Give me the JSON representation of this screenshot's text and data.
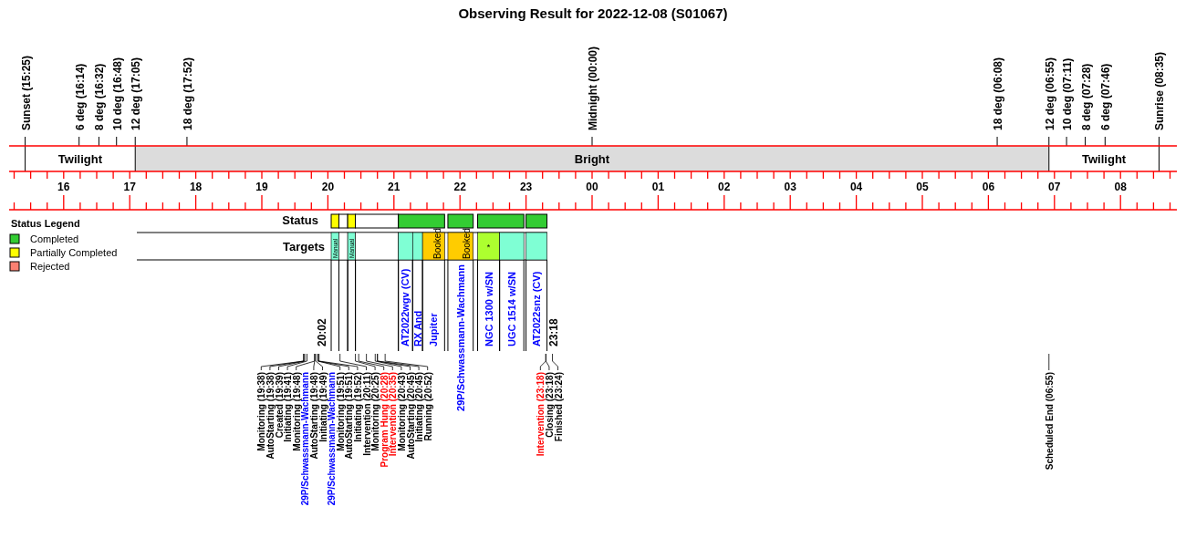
{
  "title": "Observing Result for 2022-12-08 (S01067)",
  "sky_events": [
    {
      "label": "Sunset (15:25)",
      "kind": "edge"
    },
    {
      "label": "6 deg (16:14)",
      "kind": "tick"
    },
    {
      "label": "8 deg (16:32)",
      "kind": "tick"
    },
    {
      "label": "10 deg (16:48)",
      "kind": "tick"
    },
    {
      "label": "12 deg (17:05)",
      "kind": "edge"
    },
    {
      "label": "18 deg (17:52)",
      "kind": "tick"
    },
    {
      "label": "Midnight (00:00)",
      "kind": "tick"
    },
    {
      "label": "18 deg (06:08)",
      "kind": "tick"
    },
    {
      "label": "12 deg (06:55)",
      "kind": "edge"
    },
    {
      "label": "10 deg (07:11)",
      "kind": "tick"
    },
    {
      "label": "8 deg (07:28)",
      "kind": "tick"
    },
    {
      "label": "6 deg (07:46)",
      "kind": "tick"
    },
    {
      "label": "Sunrise (08:35)",
      "kind": "edge"
    }
  ],
  "bands": [
    {
      "label": "Twilight",
      "kind": "twilight"
    },
    {
      "label": "Bright",
      "kind": "bright"
    },
    {
      "label": "Twilight",
      "kind": "twilight"
    }
  ],
  "hour_axis": [
    "16",
    "17",
    "18",
    "19",
    "20",
    "21",
    "22",
    "23",
    "00",
    "01",
    "02",
    "03",
    "04",
    "05",
    "06",
    "07",
    "08"
  ],
  "legend": {
    "title": "Status Legend",
    "items": [
      {
        "label": "Completed",
        "color": "#33cc33"
      },
      {
        "label": "Partially Completed",
        "color": "#ffff00"
      },
      {
        "label": "Rejected",
        "color": "#fa8072"
      }
    ]
  },
  "status_row": {
    "label": "Status",
    "segments": [
      {
        "color": "#ffff00"
      },
      {
        "color": "#ffffff"
      },
      {
        "color": "#ffff00"
      },
      {
        "color": "#ffffff"
      },
      {
        "color": "#33cc33"
      },
      {
        "color": "#33cc33"
      },
      {
        "color": "#33cc33"
      },
      {
        "color": "#33cc33"
      }
    ]
  },
  "targets_row": {
    "label": "Targets",
    "cells": [
      {
        "kind": "manual",
        "cell_text": "Manual"
      },
      {
        "kind": "empty"
      },
      {
        "kind": "manual",
        "cell_text": "Manual"
      },
      {
        "kind": "empty"
      },
      {
        "kind": "observed",
        "name": "AT2022wgv (CV)"
      },
      {
        "kind": "observed",
        "name": "RX And"
      },
      {
        "kind": "booked",
        "cell_text": "Booked",
        "name": "Jupiter"
      },
      {
        "kind": "booked",
        "cell_text": "Booked",
        "name": "29P/Schwassmann-Wachmann"
      },
      {
        "kind": "special",
        "cell_text": "*",
        "name": "NGC 1300 w/SN"
      },
      {
        "kind": "observed",
        "name": "UGC 1514 w/SN"
      },
      {
        "kind": "observed",
        "name": "AT2022snz (CV)"
      }
    ]
  },
  "session_marks": [
    {
      "label": "20:02"
    },
    {
      "label": "23:18"
    }
  ],
  "event_log": [
    {
      "items": [
        {
          "text": "Monitoring (19:38)",
          "color": "#000000"
        },
        {
          "text": "AutoStarting (19:38)",
          "color": "#000000"
        },
        {
          "text": "Created (19:39)",
          "color": "#000000"
        },
        {
          "text": "Initiating (19:41)",
          "color": "#000000"
        },
        {
          "text": "Monitoring (19:48)",
          "color": "#000000"
        },
        {
          "text": "29P/Schwassmann-Wachmann",
          "color": "#0000ff"
        },
        {
          "text": "AutoStarting (19:48)",
          "color": "#000000"
        },
        {
          "text": "Initiating (19:49)",
          "color": "#000000"
        },
        {
          "text": "29P/Schwassmann-Wachmann",
          "color": "#0000ff"
        },
        {
          "text": "Monitoring (19:51)",
          "color": "#000000"
        },
        {
          "text": "AutoStarting (19:51)",
          "color": "#000000"
        },
        {
          "text": "Initiating (19:52)",
          "color": "#000000"
        },
        {
          "text": "Intervention (20:11)",
          "color": "#000000"
        },
        {
          "text": "Monitoring (20:25)",
          "color": "#000000"
        },
        {
          "text": "Program Hung (20:28)",
          "color": "#ff0000"
        },
        {
          "text": "Intervention (20:35)",
          "color": "#ff0000"
        },
        {
          "text": "Monitoring (20:43)",
          "color": "#000000"
        },
        {
          "text": "AutoStarting (20:45)",
          "color": "#000000"
        },
        {
          "text": "Initiating (20:45)",
          "color": "#000000"
        },
        {
          "text": "Running (20:52)",
          "color": "#000000"
        }
      ]
    },
    {
      "items": [
        {
          "text": "Intervention (23:18)",
          "color": "#ff0000"
        },
        {
          "text": "Closing (23:18)",
          "color": "#000000"
        },
        {
          "text": "Finished (23:24)",
          "color": "#000000"
        }
      ]
    },
    {
      "items": [
        {
          "text": "Scheduled End (06:55)",
          "color": "#000000"
        }
      ]
    }
  ]
}
